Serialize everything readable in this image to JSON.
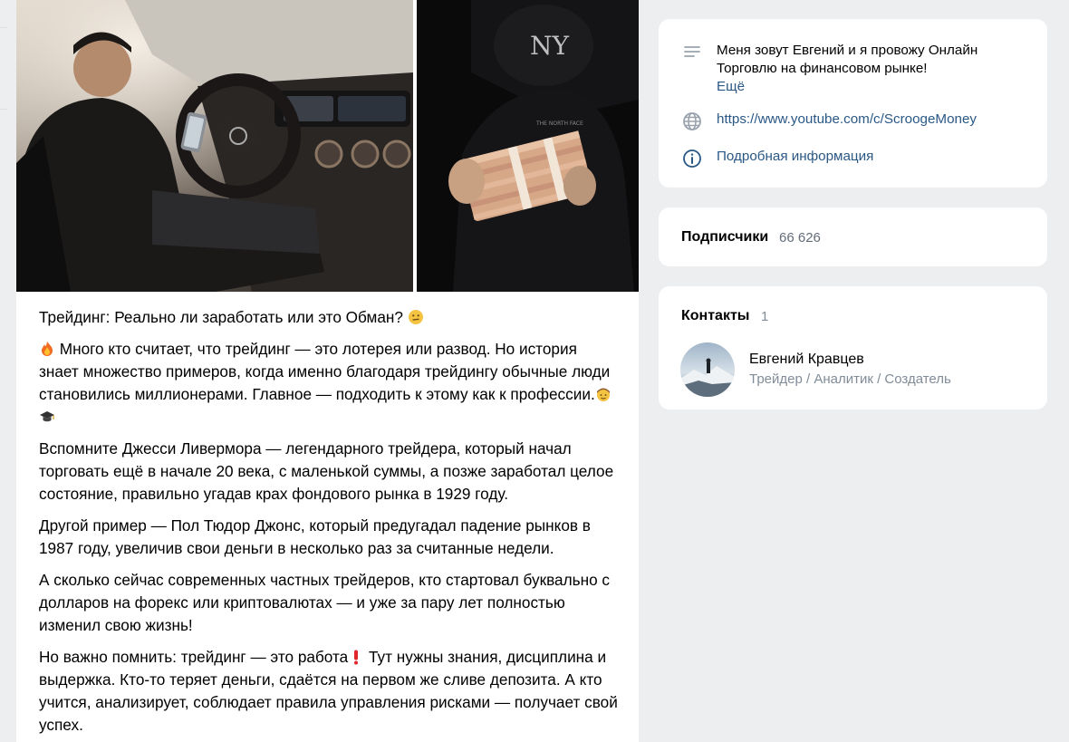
{
  "post": {
    "photos": [
      {
        "name": "car-interior-photo"
      },
      {
        "name": "money-stack-photo"
      }
    ],
    "title": "Трейдинг: Реально ли заработать или это Обман?",
    "paragraphs": [
      {
        "id": "p1",
        "text": "Много кто считает, что трейдинг — это лотерея или развод. Но история знает множество примеров, когда именно благодаря трейдингу обычные люди становились миллионерами. Главное — подходить к этому как к профессии."
      },
      {
        "id": "p2",
        "text": "Вспомните Джесси Ливермора — легендарного трейдера, который начал торговать ещё в начале 20 века, с маленькой суммы, а позже заработал целое состояние, правильно угадав крах фондового рынка в 1929 году."
      },
      {
        "id": "p3",
        "text": "Другой пример — Пол Тюдор Джонс, который предугадал падение рынков в 1987 году, увеличив свои деньги в несколько раз за считанные недели."
      },
      {
        "id": "p4",
        "text": "А сколько сейчас современных частных трейдеров, кто стартовал буквально с долларов на форекс или криптовалютах — и уже за пару лет полностью изменил свою жизнь!"
      },
      {
        "id": "p5a",
        "text": "Но важно помнить: трейдинг — это работа"
      },
      {
        "id": "p5b",
        "text": " Тут нужны знания, дисциплина и выдержка. Кто-то теряет деньги, сдаётся на первом же сливе депозита. А кто учится, анализирует, соблюдает правила управления рисками — получает свой успех."
      }
    ],
    "emojis": [
      "thinking-face-emoji",
      "fire-emoji",
      "man-face-emoji",
      "graduation-cap-emoji",
      "exclamation-emoji"
    ]
  },
  "info": {
    "description": "Меня зовут Евгений и я провожу Онлайн Торговлю на финансовом рынке!",
    "more_label": "Ещё",
    "website": "https://www.youtube.com/c/ScroogeMoney",
    "details_label": "Подробная информация"
  },
  "subscribers": {
    "label": "Подписчики",
    "count": "66 626"
  },
  "contacts": {
    "title": "Контакты",
    "count": "1",
    "items": [
      {
        "name": "Евгений Кравцев",
        "role": "Трейдер / Аналитик / Создатель"
      }
    ]
  },
  "colors": {
    "background": "#edeef0",
    "link": "#2a5885",
    "secondary_text": "#818c99",
    "icon": "#99a2ad"
  }
}
